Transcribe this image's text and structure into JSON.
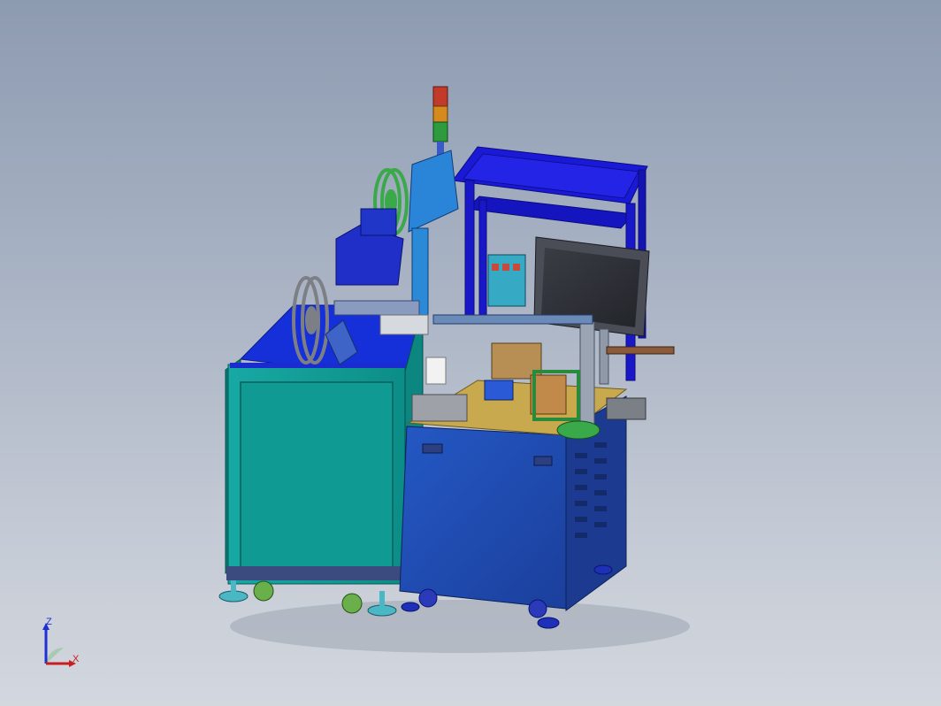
{
  "viewport": {
    "background_top": "#8d9bb1",
    "background_bottom": "#d3d7de"
  },
  "model": {
    "colors": {
      "teal_cabinet": "#0f9b95",
      "blue_cabinet": "#1f4fb5",
      "deep_blue": "#1a1ad6",
      "top_plate": "#c9a94d",
      "screen": "#2b2e33",
      "tower_blue": "#1e7fd6",
      "reel_green": "#3aa94a"
    }
  },
  "triad": {
    "z_label": "Z",
    "x_label": "X",
    "z_color": "#1f2fd0",
    "x_color": "#c81e1e"
  }
}
